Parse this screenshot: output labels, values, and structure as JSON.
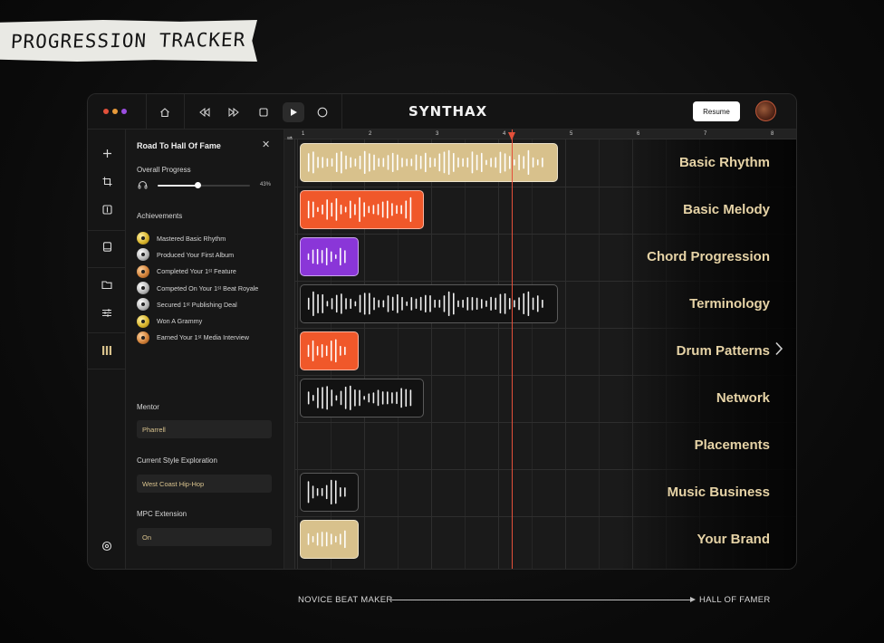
{
  "header_label": "PROGRESSION TRACKER",
  "colors": {
    "gold": "#d8c18c",
    "orange": "#f0582a",
    "purple": "#8a36d8",
    "dark": "#121212",
    "playhead": "#e4503a"
  },
  "topbar": {
    "logo": "SYNTHAX",
    "resume_label": "Resume",
    "window_dots": [
      "#e2513b",
      "#e79a3a",
      "#9b4ee0"
    ],
    "icons": [
      "home-icon",
      "rewind-icon",
      "fast-forward-icon",
      "stop-icon",
      "play-icon",
      "record-icon"
    ]
  },
  "rail_icons": [
    "plus-icon",
    "crop-icon",
    "split-icon",
    "tablet-icon",
    "folder-icon",
    "sliders-icon",
    "library-icon",
    "settings-icon"
  ],
  "panel": {
    "title": "Road To Hall Of Fame",
    "close_icon": "✕",
    "overall_progress_label": "Overall Progress",
    "progress_value": 43,
    "progress_text": "43%",
    "achievements_label": "Achievements",
    "achievements": [
      {
        "text": "Mastered Basic Rhythm",
        "medal": "gold"
      },
      {
        "text": "Produced Your First Album",
        "medal": "silver"
      },
      {
        "text": "Completed Your 1ˢᵗ Feature",
        "medal": "bronze"
      },
      {
        "text": "Competed On Your 1ˢᵗ Beat Royale",
        "medal": "silver"
      },
      {
        "text": "Secured 1ˢᵗ Publishing Deal",
        "medal": "silver"
      },
      {
        "text": "Won A Grammy",
        "medal": "gold"
      },
      {
        "text": "Earned Your 1ˢᵗ Media Interview",
        "medal": "bronze"
      }
    ],
    "mentor_label": "Mentor",
    "mentor_value": "Pharrell",
    "style_label": "Current Style Exploration",
    "style_value": "West Coast Hip-Hop",
    "mpc_label": "MPC Extension",
    "mpc_value": "On"
  },
  "timeline": {
    "ruler": [
      "1",
      "2",
      "3",
      "4",
      "5",
      "6",
      "7",
      "8"
    ],
    "playhead_position": 4.2,
    "tracks": [
      {
        "label": "Basic Rhythm",
        "clip_color": "gold",
        "clip_start": 1,
        "clip_end": 4.85
      },
      {
        "label": "Basic Melody",
        "clip_color": "orange",
        "clip_start": 1,
        "clip_end": 2.85
      },
      {
        "label": "Chord Progression",
        "clip_color": "purple",
        "clip_start": 1,
        "clip_end": 1.88
      },
      {
        "label": "Terminology",
        "clip_color": "dark",
        "clip_start": 1,
        "clip_end": 4.85
      },
      {
        "label": "Drum Patterns",
        "clip_color": "orange",
        "clip_start": 1,
        "clip_end": 1.88
      },
      {
        "label": "Network",
        "clip_color": "dark",
        "clip_start": 1,
        "clip_end": 2.85
      },
      {
        "label": "Placements",
        "clip_color": null,
        "clip_start": null,
        "clip_end": null
      },
      {
        "label": "Music Business",
        "clip_color": "dark",
        "clip_start": 1,
        "clip_end": 1.88
      },
      {
        "label": "Your Brand",
        "clip_color": "gold",
        "clip_start": 1,
        "clip_end": 1.88
      }
    ]
  },
  "footer": {
    "start_label": "NOVICE BEAT MAKER",
    "end_label": "HALL OF FAMER"
  }
}
